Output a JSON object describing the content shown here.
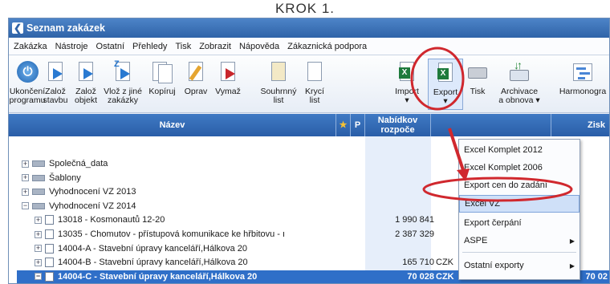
{
  "step_label": "KROK 1.",
  "window": {
    "title": "Seznam zakázek"
  },
  "menu": [
    "Zakázka",
    "Nástroje",
    "Ostatní",
    "Přehledy",
    "Tisk",
    "Zobrazit",
    "Nápověda",
    "Zákaznická podpora"
  ],
  "toolbar": {
    "buttons": [
      {
        "line1": "Ukončení",
        "line2": "programu",
        "icon": "power-icon"
      },
      {
        "line1": "Založ",
        "line2": "stavbu",
        "icon": "new-building-icon"
      },
      {
        "line1": "Založ",
        "line2": "objekt",
        "icon": "new-object-icon"
      },
      {
        "line1": "Vlož z jiné",
        "line2": "zakázky",
        "icon": "insert-from-order-icon"
      },
      {
        "line1": "Kopíruj",
        "line2": "",
        "icon": "copy-icon"
      },
      {
        "line1": "Oprav",
        "line2": "",
        "icon": "edit-icon"
      },
      {
        "line1": "Vymaž",
        "line2": "",
        "icon": "delete-icon"
      },
      {
        "line1": "Souhrnný",
        "line2": "list",
        "icon": "summary-sheet-icon"
      },
      {
        "line1": "Krycí",
        "line2": "list",
        "icon": "cover-sheet-icon"
      },
      {
        "line1": "Import",
        "line2": "▾",
        "icon": "import-excel-icon"
      },
      {
        "line1": "Export",
        "line2": "▾",
        "icon": "export-excel-icon"
      },
      {
        "line1": "Tisk",
        "line2": "",
        "icon": "printer-icon"
      },
      {
        "line1": "Archivace",
        "line2": "a obnova ▾",
        "icon": "archive-icon"
      },
      {
        "line1": "Harmonogra",
        "line2": "",
        "icon": "gantt-icon"
      }
    ]
  },
  "columns": {
    "name": "Název",
    "star": "★",
    "p": "P",
    "budget": "Nabídkov rozpoče",
    "profit": "Zisk"
  },
  "tree": [
    {
      "label": "Společná_data",
      "expander": "+",
      "type": "folder",
      "indent": 0
    },
    {
      "label": "Šablony",
      "expander": "+",
      "type": "folder",
      "indent": 0
    },
    {
      "label": "Vyhodnocení VZ 2013",
      "expander": "+",
      "type": "folder",
      "indent": 0
    },
    {
      "label": "Vyhodnocení VZ 2014",
      "expander": "−",
      "type": "folder",
      "indent": 0
    },
    {
      "label": "13018 - Kosmonautů 12-20",
      "expander": "+",
      "type": "file",
      "indent": 1,
      "value": "1 990 841",
      "currency": ""
    },
    {
      "label": "13035 - Chomutov - přístupová komunikace ke hřbitovu - ı",
      "expander": "+",
      "type": "file",
      "indent": 1,
      "value": "2 387 329",
      "currency": ""
    },
    {
      "label": "14004-A - Stavební úpravy kanceláří,Hálkova 20",
      "expander": "+",
      "type": "file",
      "indent": 1,
      "value": "",
      "currency": ""
    },
    {
      "label": "14004-B - Stavební úpravy kanceláří,Hálkova 20",
      "expander": "+",
      "type": "file",
      "indent": 1,
      "value": "165 710",
      "currency": "CZK"
    },
    {
      "label": "14004-C - Stavební úpravy kanceláří,Hálkova 20",
      "expander": "−",
      "type": "file",
      "indent": 1,
      "value": "70 028",
      "currency": "CZK",
      "selected": true,
      "profit": "70 02"
    }
  ],
  "export_menu": [
    {
      "label": "Excel Komplet 2012",
      "submenu": false
    },
    {
      "label": "Excel Komplet 2006",
      "submenu": false
    },
    {
      "label": "Export cen do zadání",
      "submenu": false
    },
    {
      "label": "Excel VZ",
      "submenu": false,
      "highlighted": true
    },
    {
      "label": "Export čerpání",
      "submenu": false
    },
    {
      "label": "ASPE",
      "submenu": true
    },
    {
      "label": "Ostatní exporty",
      "submenu": true
    }
  ],
  "annotation_color": "#d0282e"
}
